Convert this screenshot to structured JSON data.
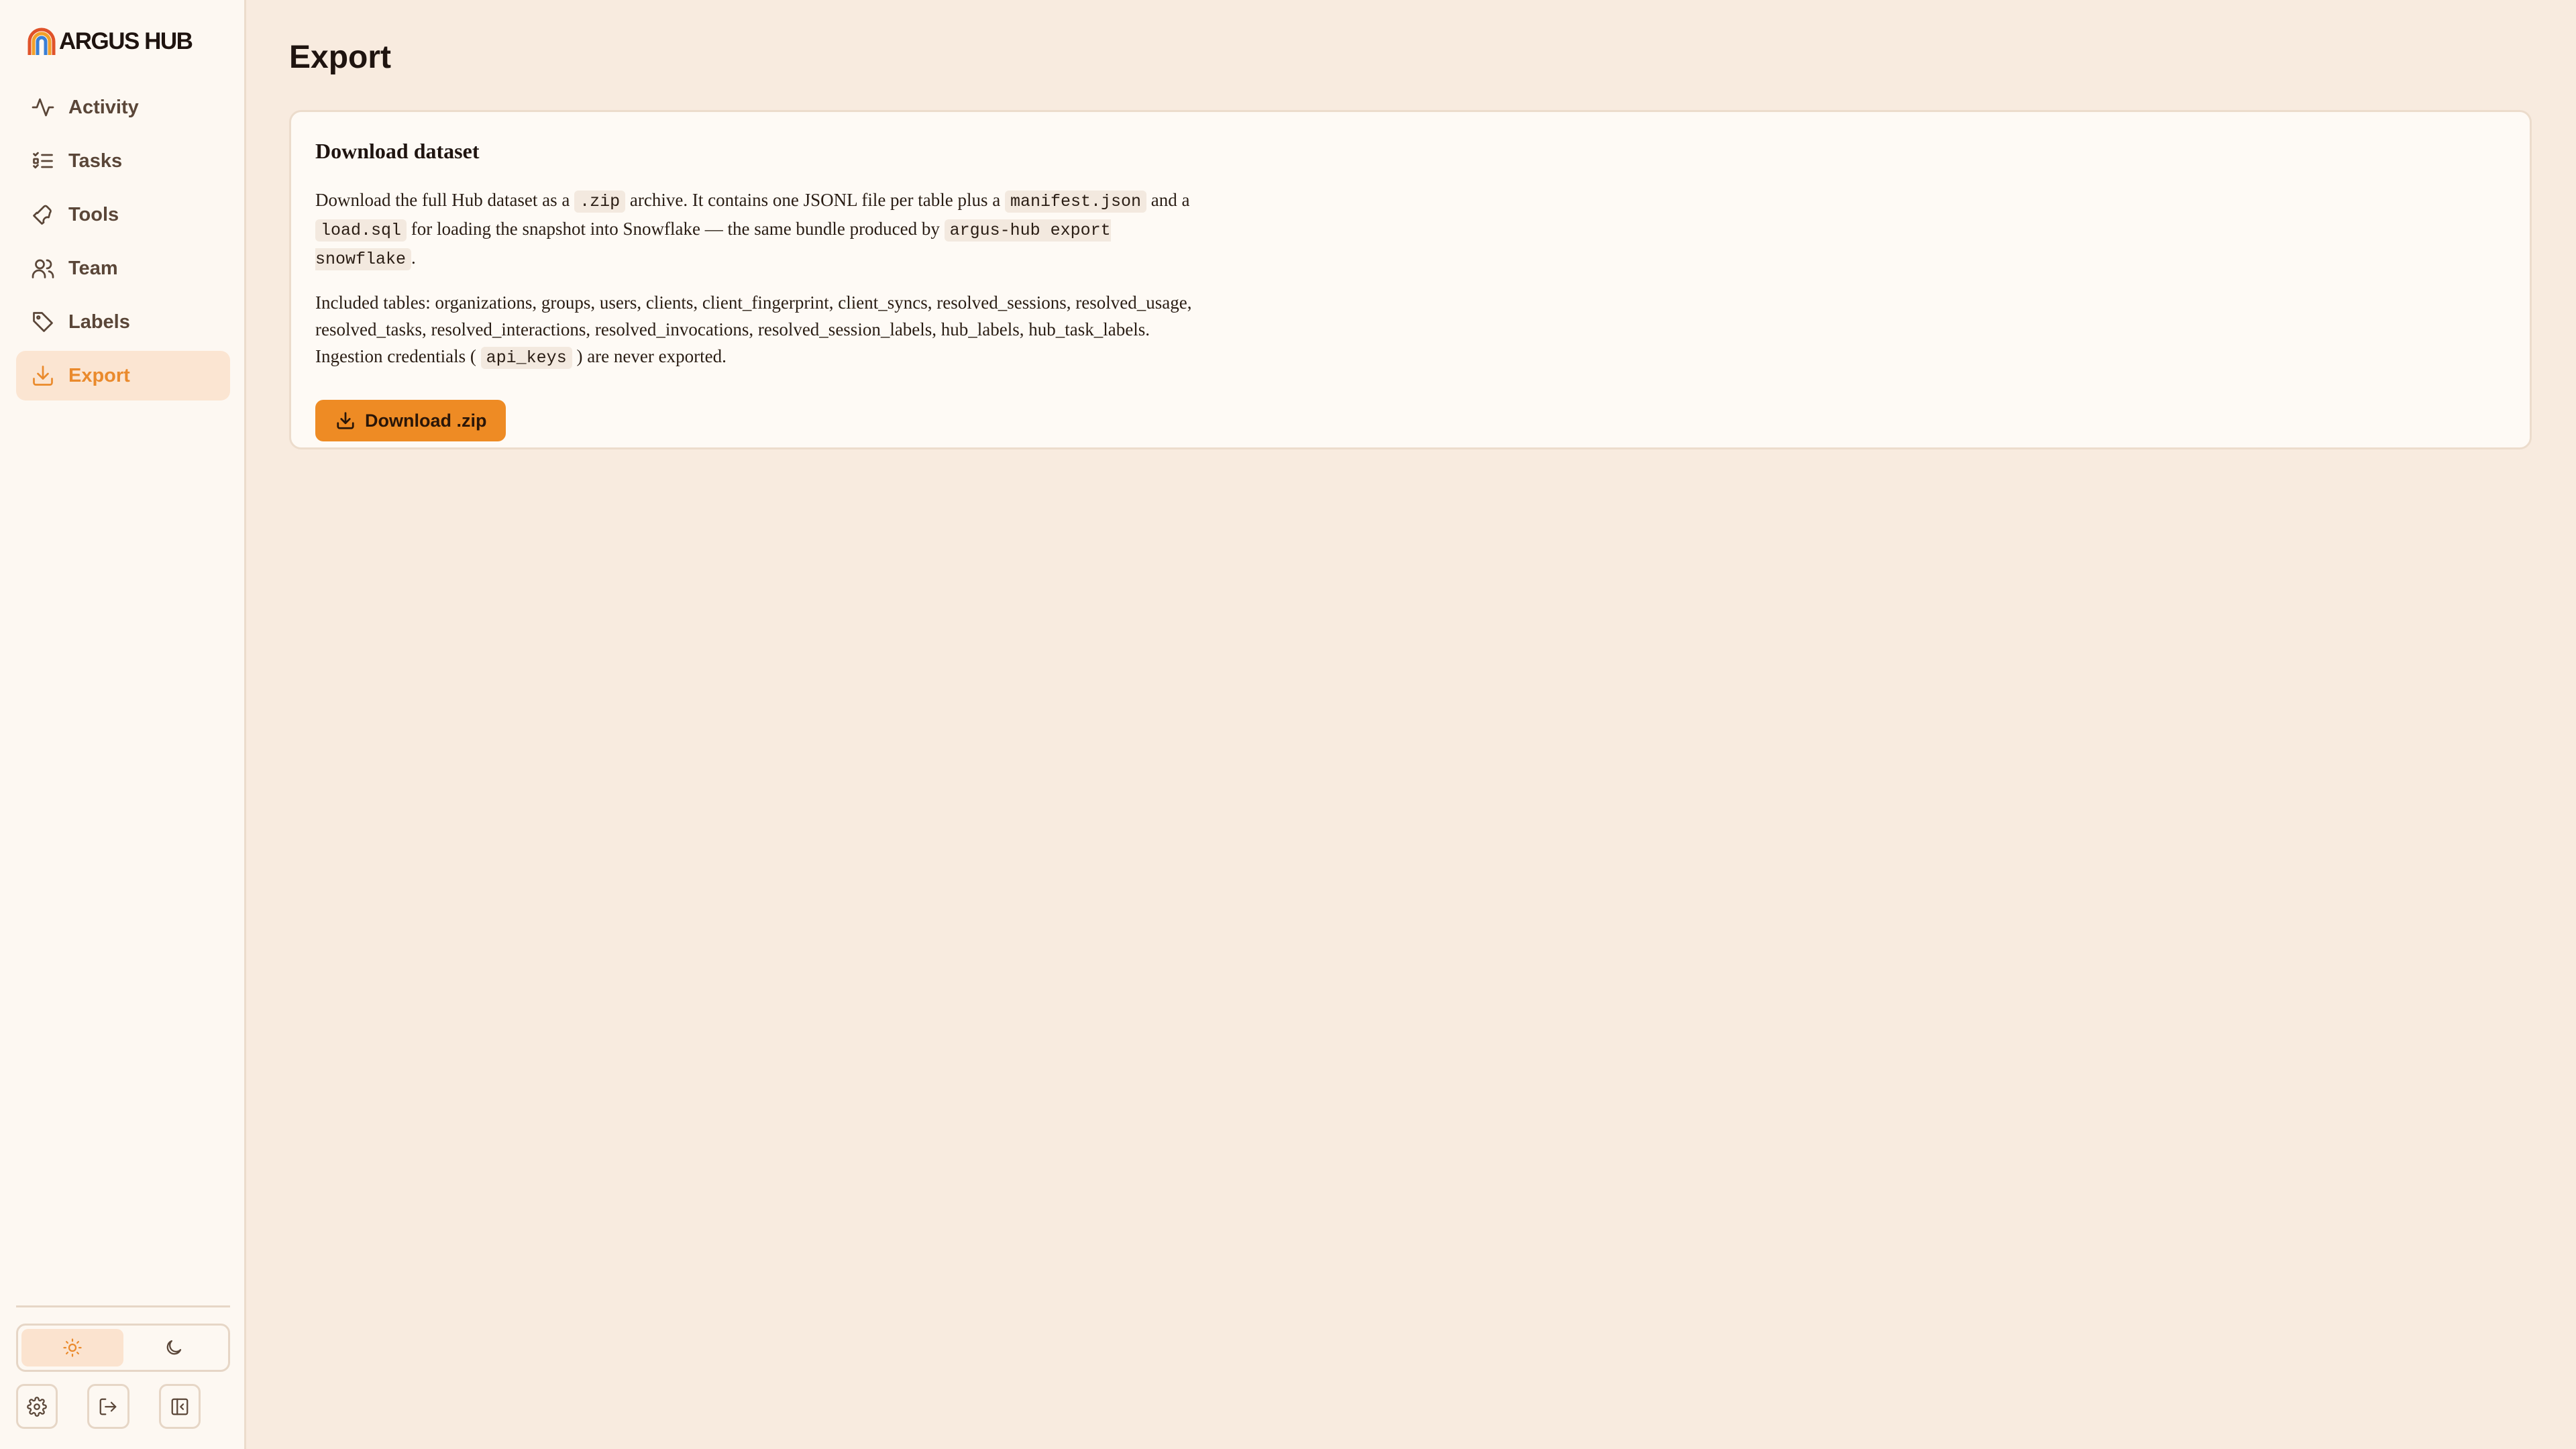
{
  "brand": {
    "name": "ARGUS HUB",
    "logo_icon": "rainbow-arch-logo"
  },
  "sidebar": {
    "items": [
      {
        "label": "Activity",
        "icon": "activity-icon",
        "active": false
      },
      {
        "label": "Tasks",
        "icon": "tasks-icon",
        "active": false
      },
      {
        "label": "Tools",
        "icon": "wrench-icon",
        "active": false
      },
      {
        "label": "Team",
        "icon": "team-icon",
        "active": false
      },
      {
        "label": "Labels",
        "icon": "tag-icon",
        "active": false
      },
      {
        "label": "Export",
        "icon": "download-icon",
        "active": true
      }
    ],
    "theme": {
      "selected": "light",
      "options": [
        "light",
        "dark"
      ]
    },
    "bottom_buttons": [
      "settings-icon",
      "logout-icon",
      "collapse-sidebar-icon"
    ]
  },
  "page": {
    "title": "Export",
    "card": {
      "title": "Download dataset",
      "p1": {
        "t1": "Download the full Hub dataset as a ",
        "c1": ".zip",
        "t2": " archive. It contains one JSONL file per table plus a ",
        "c2": "manifest.json",
        "t3": " and a ",
        "c3": "load.sql",
        "t4": " for loading the snapshot into Snowflake — the same bundle produced by ",
        "c4": "argus-hub export snowflake",
        "t5": "."
      },
      "p2": {
        "t1": "Included tables: organizations, groups, users, clients, client_fingerprint, client_syncs, resolved_sessions, resolved_usage, resolved_tasks, resolved_interactions, resolved_invocations, resolved_session_labels, hub_labels, hub_task_labels. Ingestion credentials ( ",
        "c1": "api_keys",
        "t2": " ) are never exported."
      },
      "button_label": "Download .zip"
    }
  },
  "colors": {
    "accent": "#ee8b24",
    "active_text": "#ea8a2c",
    "active_bg": "#fbe5d2",
    "page_bg": "#f8ebdf",
    "sidebar_bg": "#fdf8f2"
  }
}
